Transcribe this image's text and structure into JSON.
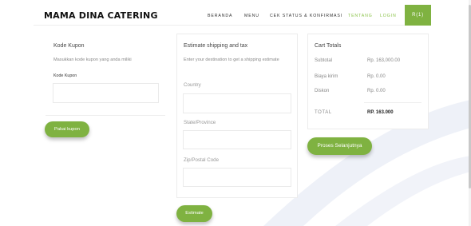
{
  "colors": {
    "accent": "#7fb241",
    "nav_active": "#8bc34a",
    "arc": "#eef1f8"
  },
  "header": {
    "brand": "MAMA DINA CATERING",
    "nav": [
      {
        "label": "BERANDA",
        "active": false
      },
      {
        "label": "MENU",
        "active": false
      },
      {
        "label": "CEK STATUS & KONFIRMASI",
        "active": false
      },
      {
        "label": "TENTANG",
        "active": true
      },
      {
        "label": "LOGIN",
        "active": true
      }
    ],
    "cart_label": "R(1)"
  },
  "coupon": {
    "title": "Kode Kupon",
    "description": "Masukkan kode kupon yang anda miliki",
    "field_label": "Kode Kupon",
    "input_value": "",
    "button_label": "Pakai kupon"
  },
  "shipping": {
    "title": "Estimate shipping and tax",
    "description": "Enter your destination to get a shipping estimate",
    "country_placeholder": "Country",
    "state_placeholder": "State/Province",
    "zip_placeholder": "Zip/Postal Code",
    "button_label": "Estimate"
  },
  "totals": {
    "title": "Cart Totals",
    "rows": [
      {
        "label": "Subtotal",
        "value": "Rp. 163,000.00"
      },
      {
        "label": "Biaya kirim",
        "value": "Rp. 0.00"
      },
      {
        "label": "Diskon",
        "value": "Rp. 0.00"
      }
    ],
    "total_label": "TOTAL",
    "total_value": "RP. 163.000",
    "checkout_label": "Proses Selanjutnya"
  }
}
